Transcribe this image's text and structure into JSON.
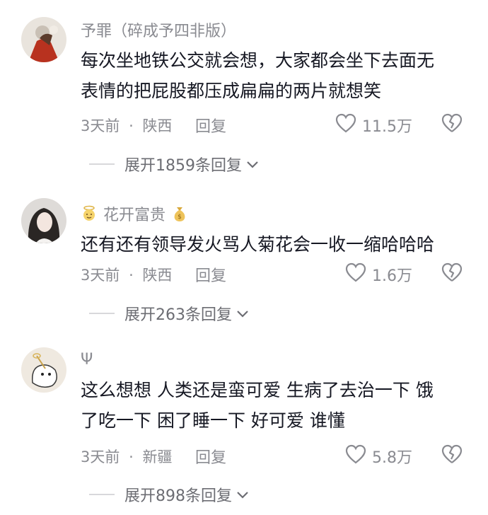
{
  "comments": [
    {
      "username": "予罪（碎成予四非版）",
      "text_line1": "每次坐地铁公交就会想，大家都会坐下去面无",
      "text_line2": "表情的把屁股都压成扁扁的两片就想笑",
      "time": "3天前",
      "location": "陕西",
      "reply_label": "回复",
      "likes": "11.5万",
      "expand_label": "展开1859条回复"
    },
    {
      "username": "花开富贵",
      "text_line1": "还有还有领导发火骂人菊花会一收一缩哈哈哈",
      "text_line2": "",
      "time": "3天前",
      "location": "陕西",
      "reply_label": "回复",
      "likes": "1.6万",
      "expand_label": "展开263条回复"
    },
    {
      "username": "Ψ",
      "text_line1": "这么想想 人类还是蛮可爱 生病了去治一下 饿",
      "text_line2": "了吃一下 困了睡一下 好可爱 谁懂",
      "time": "3天前",
      "location": "新疆",
      "reply_label": "回复",
      "likes": "5.8万",
      "expand_label": "展开898条回复"
    }
  ],
  "separator": "·",
  "colors": {
    "text": "#161823",
    "secondary": "#8a8b91",
    "background": "#ffffff"
  },
  "icons": [
    "heart-icon",
    "broken-heart-icon",
    "chevron-down-icon"
  ]
}
